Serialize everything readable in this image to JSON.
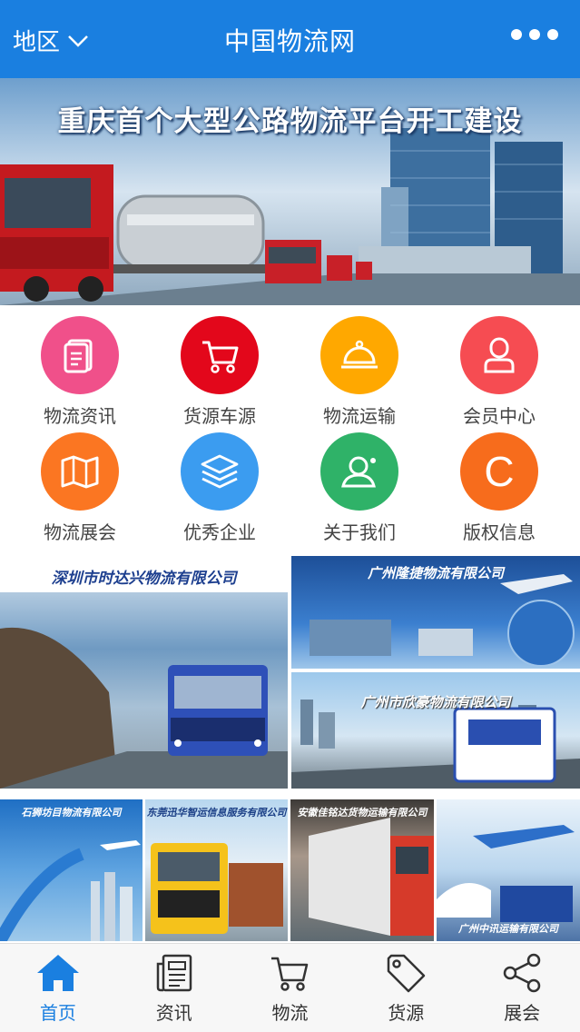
{
  "header": {
    "region_label": "地区",
    "title": "中国物流网"
  },
  "banner": {
    "title": "重庆首个大型公路物流平台开工建设"
  },
  "grid": {
    "items": [
      {
        "label": "物流资讯",
        "icon": "document-icon",
        "color": "#f0508a"
      },
      {
        "label": "货源车源",
        "icon": "cart-icon",
        "color": "#e3071b"
      },
      {
        "label": "物流运输",
        "icon": "service-bell-icon",
        "color": "#ffa800"
      },
      {
        "label": "会员中心",
        "icon": "user-icon",
        "color": "#f64c52"
      },
      {
        "label": "物流展会",
        "icon": "map-icon",
        "color": "#fb7622"
      },
      {
        "label": "优秀企业",
        "icon": "layers-icon",
        "color": "#3b9cf0"
      },
      {
        "label": "关于我们",
        "icon": "contact-icon",
        "color": "#2fb268"
      },
      {
        "label": "版权信息",
        "icon": "copyright-icon",
        "color": "#f76c1c"
      }
    ]
  },
  "companies": {
    "large_left": "深圳市时达兴物流有限公司",
    "right_top": "广州隆捷物流有限公司",
    "right_bottom": "广州市欣豪物流有限公司",
    "small_1": "石狮坊目物流有限公司",
    "small_2": "东莞迅华智运信息服务有限公司",
    "small_3": "安徽佳铭达货物运输有限公司",
    "small_4": "广州中讯运输有限公司"
  },
  "bottom_nav": {
    "items": [
      {
        "label": "首页",
        "icon": "home-icon",
        "active": true
      },
      {
        "label": "资讯",
        "icon": "newspaper-icon",
        "active": false
      },
      {
        "label": "物流",
        "icon": "cart-icon",
        "active": false
      },
      {
        "label": "货源",
        "icon": "tag-icon",
        "active": false
      },
      {
        "label": "展会",
        "icon": "share-icon",
        "active": false
      }
    ]
  },
  "colors": {
    "primary": "#1a7fe0"
  }
}
